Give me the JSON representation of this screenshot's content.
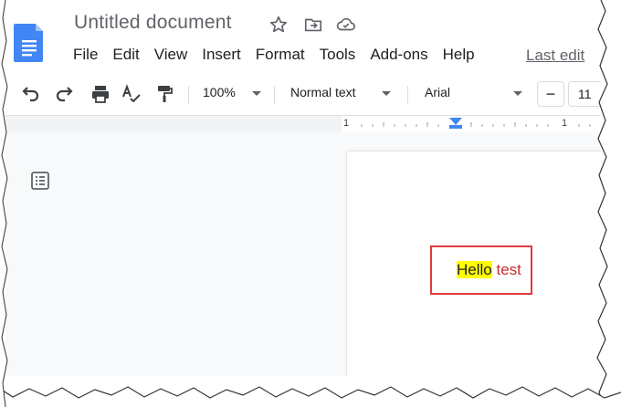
{
  "document": {
    "title": "Untitled document",
    "last_edit": "Last edit",
    "body_text_highlighted": "Hello",
    "body_text_colored": "test"
  },
  "menu": {
    "items": [
      "File",
      "Edit",
      "View",
      "Insert",
      "Format",
      "Tools",
      "Add-ons",
      "Help"
    ]
  },
  "toolbar": {
    "zoom": "100%",
    "paragraph_style": "Normal text",
    "font": "Arial",
    "font_size": "11",
    "minus": "−"
  },
  "ruler": {
    "left_label": "1",
    "right_label": "1"
  },
  "icons": {
    "app_logo": "docs-logo-icon",
    "star": "star-icon",
    "move": "move-to-folder-icon",
    "cloud": "cloud-status-icon",
    "undo": "undo-icon",
    "redo": "redo-icon",
    "print": "print-icon",
    "spellcheck": "spellcheck-icon",
    "paint_format": "paint-format-icon",
    "outline": "document-outline-icon"
  },
  "colors": {
    "highlight": "#ffff00",
    "text_red": "#cc2b2b",
    "callout_border": "#e03b3b",
    "docs_blue": "#4285f4"
  }
}
